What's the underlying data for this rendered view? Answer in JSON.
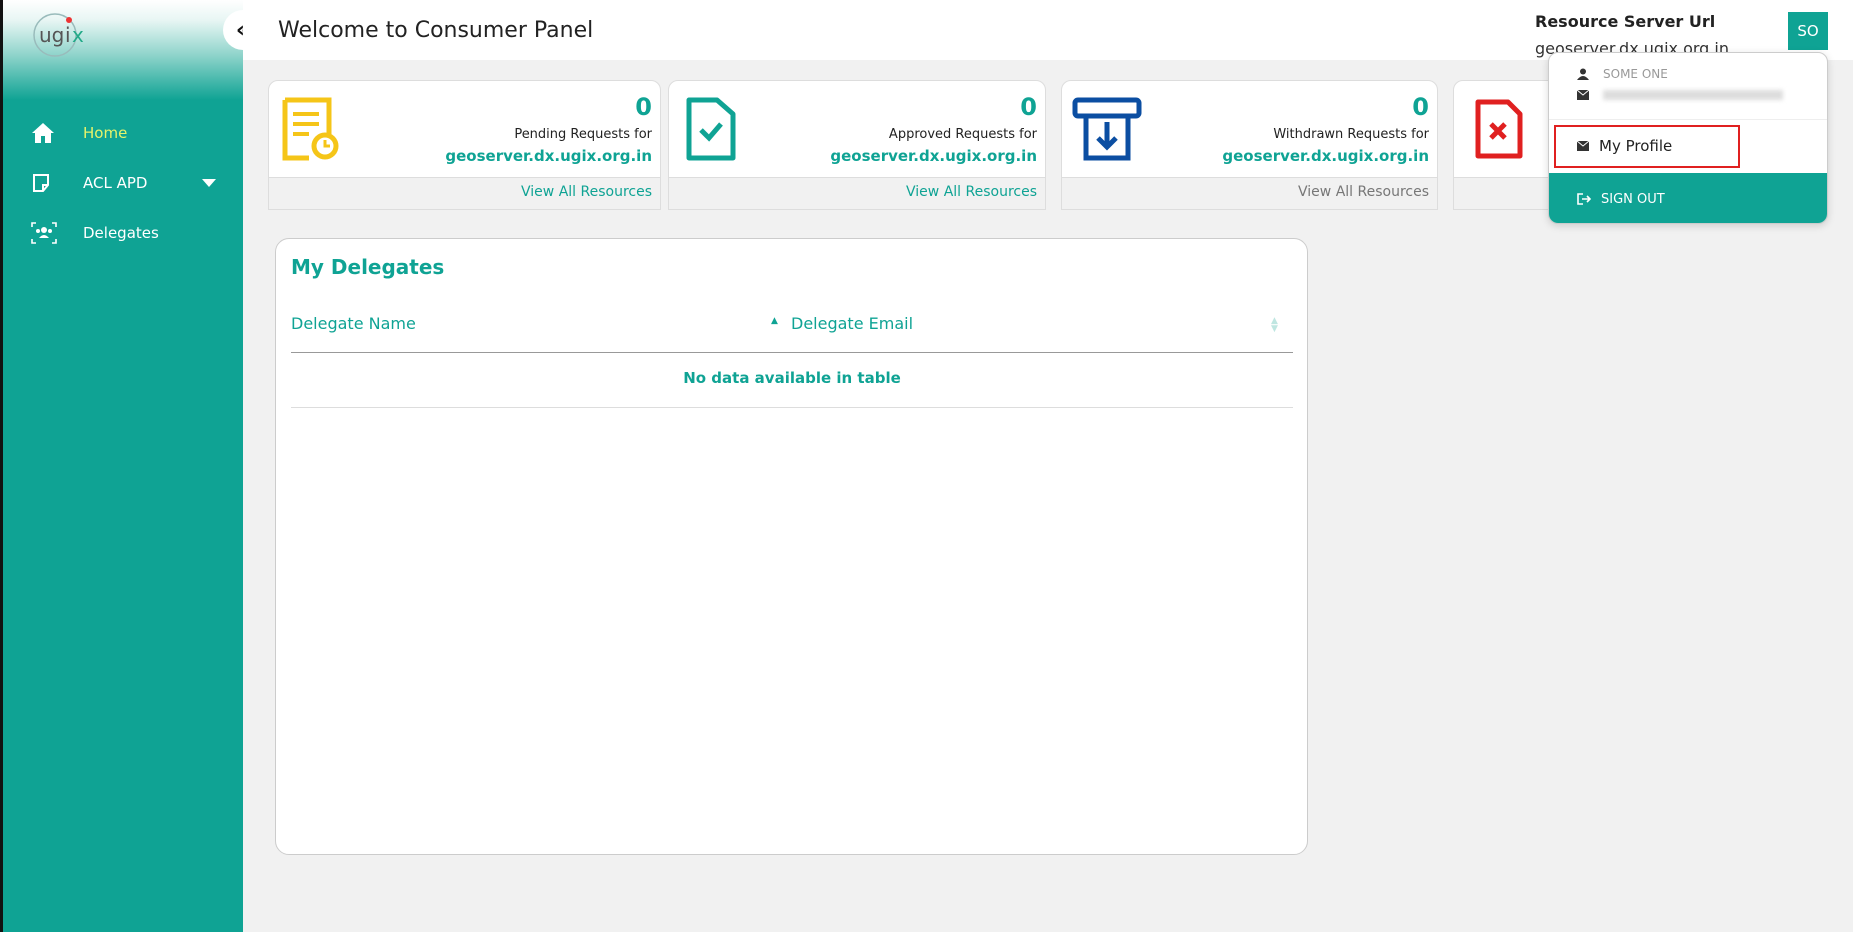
{
  "app": {
    "logo_text": "ugix"
  },
  "header": {
    "title": "Welcome to Consumer Panel",
    "resource_label": "Resource Server Url",
    "resource_value": "geoserver.dx.ugix.org.in",
    "avatar_initials": "SO"
  },
  "sidebar": {
    "items": [
      {
        "label": "Home",
        "icon": "home-icon",
        "active": true
      },
      {
        "label": "ACL APD",
        "icon": "note-icon",
        "has_dropdown": true
      },
      {
        "label": "Delegates",
        "icon": "delegates-icon"
      }
    ]
  },
  "cards": [
    {
      "count": "0",
      "desc": "Pending Requests for",
      "host": "geoserver.dx.ugix.org.in",
      "link": "View All Resources",
      "icon": "pending-doc-icon",
      "color": "#f5c518"
    },
    {
      "count": "0",
      "desc": "Approved Requests for",
      "host": "geoserver.dx.ugix.org.in",
      "link": "View All Resources",
      "icon": "approved-doc-icon",
      "color": "#0fa394"
    },
    {
      "count": "0",
      "desc": "Withdrawn Requests for",
      "host": "geoserver.dx.ugix.org.in",
      "link": "View All Resources",
      "icon": "withdraw-icon",
      "color": "#0b4ea2"
    },
    {
      "icon": "rejected-doc-icon",
      "color": "#e02020"
    }
  ],
  "delegates": {
    "title": "My Delegates",
    "columns": [
      "Delegate Name",
      "Delegate Email"
    ],
    "empty_text": "No data available in table"
  },
  "dropdown": {
    "user_name": "SOME ONE",
    "my_profile": "My Profile",
    "sign_out": "SIGN OUT"
  },
  "colors": {
    "primary": "#0fa394",
    "active_nav": "#e6f36a",
    "highlight": "#e02020"
  }
}
